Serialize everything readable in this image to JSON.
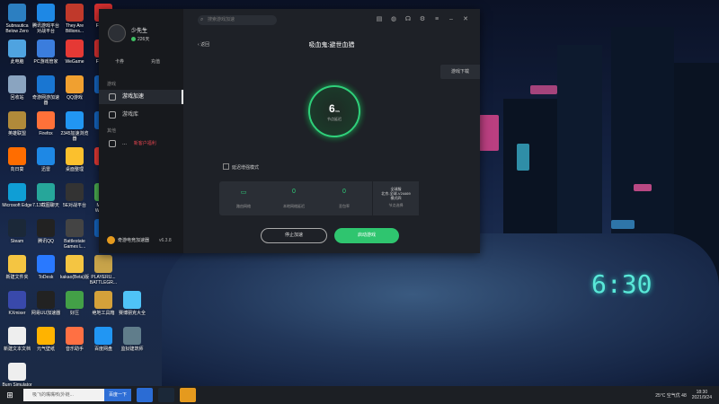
{
  "desktop_icons": [
    {
      "label": "Subnautica Below Zero",
      "color": "#2c7fc1",
      "icon": "subnautica-icon"
    },
    {
      "label": "腾讯游戏平台对战平台",
      "color": "#1e88e5",
      "icon": "tencent-game-icon"
    },
    {
      "label": "They Are Billions...",
      "color": "#c0392b",
      "icon": "they-are-billions-icon"
    },
    {
      "label": "Flash...",
      "color": "#d32f2f",
      "icon": "flash-icon"
    },
    {
      "label": "此电脑",
      "color": "#4fa3e0",
      "icon": "computer-icon"
    },
    {
      "label": "PC游戏管家",
      "color": "#3b7ddd",
      "icon": "pc-manager-icon"
    },
    {
      "label": "WeGame",
      "color": "#e53935",
      "icon": "wegame-icon"
    },
    {
      "label": "Flash...",
      "color": "#d32f2f",
      "icon": "flash-icon"
    },
    {
      "label": "回收站",
      "color": "#8aa4c0",
      "icon": "recycle-bin-icon"
    },
    {
      "label": "奇游网游加速器",
      "color": "#1976d2",
      "icon": "qiyou-icon"
    },
    {
      "label": "QQ游戏",
      "color": "#f0a030",
      "icon": "qq-game-icon"
    },
    {
      "label": "...",
      "color": "#1565c0",
      "icon": "app-icon"
    },
    {
      "label": "英雄联盟",
      "color": "#b08a3a",
      "icon": "lol-icon"
    },
    {
      "label": "Firefox",
      "color": "#ff7139",
      "icon": "firefox-icon"
    },
    {
      "label": "2345加速浏览器",
      "color": "#2196f3",
      "icon": "browser-icon"
    },
    {
      "label": "...",
      "color": "#1565c0",
      "icon": "app-icon"
    },
    {
      "label": "向日葵",
      "color": "#ff6d00",
      "icon": "sunflower-icon"
    },
    {
      "label": "迅雷",
      "color": "#1e88e5",
      "icon": "xunlei-icon"
    },
    {
      "label": "桌面整理",
      "color": "#fbc02d",
      "icon": "desktop-organizer-icon"
    },
    {
      "label": "Or...",
      "color": "#e53935",
      "icon": "app-icon"
    },
    {
      "label": "Microsoft Edge",
      "color": "#0f9ed5",
      "icon": "edge-icon"
    },
    {
      "label": "7.13截图聊天",
      "color": "#26a69a",
      "icon": "chat-icon"
    },
    {
      "label": "5E对战平台",
      "color": "#333333",
      "icon": "5e-icon"
    },
    {
      "label": "Mine... Windo...",
      "color": "#4caf50",
      "icon": "minecraft-icon"
    },
    {
      "label": "Steam",
      "color": "#1b2838",
      "icon": "steam-icon"
    },
    {
      "label": "腾讯QQ",
      "color": "#222222",
      "icon": "qq-icon"
    },
    {
      "label": "Battlestate Games L...",
      "color": "#444444",
      "icon": "battlestate-icon"
    },
    {
      "label": "...",
      "color": "#1565c0",
      "icon": "app-icon"
    },
    {
      "label": "新建文件夹",
      "color": "#f4c542",
      "icon": "folder-icon"
    },
    {
      "label": "ToDesk",
      "color": "#2979ff",
      "icon": "todesk-icon"
    },
    {
      "label": "kakao(Beta)版",
      "color": "#f4c542",
      "icon": "kakao-icon"
    },
    {
      "label": "PLAYERU... BATTLEGR...",
      "color": "#c8a44a",
      "icon": "pubg-icon"
    },
    {
      "label": "KXmixer",
      "color": "#3949ab",
      "icon": "kxmixer-icon"
    },
    {
      "label": "网易UU加速器",
      "color": "#222222",
      "icon": "uu-icon"
    },
    {
      "label": "好压",
      "color": "#43a047",
      "icon": "haozip-icon"
    },
    {
      "label": "绝地工具箱",
      "color": "#d4a13a",
      "icon": "toolbox-icon"
    },
    {
      "label": "赛博朋克大全",
      "color": "#4fc3f7",
      "icon": "cyberpunk-icon"
    },
    {
      "label": "新建文本文档",
      "color": "#eeeeee",
      "icon": "text-document-icon"
    },
    {
      "label": "元气壁纸",
      "color": "#ffb300",
      "icon": "wallpaper-icon"
    },
    {
      "label": "音乐助手",
      "color": "#ff7043",
      "icon": "music-icon"
    },
    {
      "label": "百度网盘",
      "color": "#2196f3",
      "icon": "baidu-pan-icon"
    },
    {
      "label": "监狱建筑师",
      "color": "#607d8b",
      "icon": "prison-architect-icon"
    },
    {
      "label": "Burn Simulator",
      "color": "#eeeeee",
      "icon": "burn-simulator-icon"
    }
  ],
  "app": {
    "user": {
      "name": "少先生",
      "days": "226天"
    },
    "mini_actions": [
      "卡券",
      "充值"
    ],
    "section_game": "游戏",
    "nav": [
      {
        "label": "游戏加速",
        "active": true
      },
      {
        "label": "游戏库",
        "active": false
      }
    ],
    "section_other": "其他",
    "promo": {
      "label": "...",
      "tag": "新客户福利"
    },
    "brand": {
      "name": "奇游电竞加速器",
      "version": "v6.3.8"
    },
    "search_placeholder": "搜索游戏加速",
    "back_label": "返回",
    "game_title": "吸血鬼:避世血猎",
    "side_button": "游戏下载",
    "ping": {
      "value": "6",
      "unit": "ms",
      "label": "节点延迟"
    },
    "checkbox_label": "延迟增强模式",
    "stats": [
      {
        "value": "",
        "label": "路由网络"
      },
      {
        "value": "0",
        "label": "本地网络延迟"
      },
      {
        "value": "0",
        "label": "丢包率"
      }
    ],
    "server": {
      "line1": "全球服",
      "line2": "北京-全球-V24469",
      "line3": "模式四",
      "label": "节点选择"
    },
    "stop_button": "停止加速",
    "launch_button": "启动游戏"
  },
  "taskbar": {
    "search_placeholder": "吸飞的嘴嘴咳(外链...",
    "search_button": "百度一下",
    "weather": "25°C 空气优 48",
    "time": "18:30",
    "date": "2021/9/24"
  }
}
